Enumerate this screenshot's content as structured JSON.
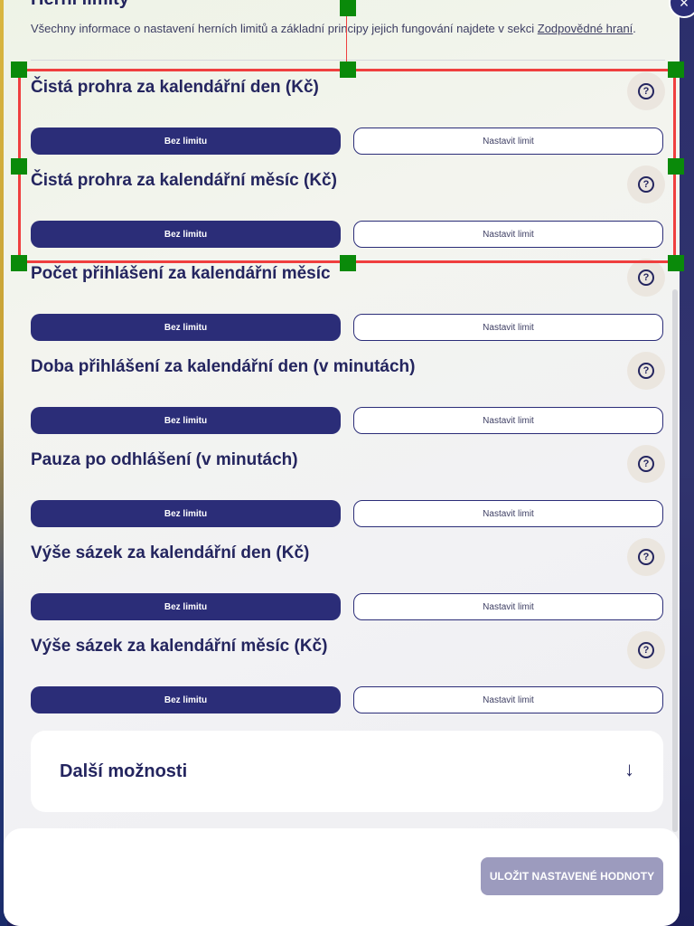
{
  "modal": {
    "title": "Herní limity",
    "info_text": "Všechny informace o nastavení herních limitů a základní principy jejich fungování najdete v sekci",
    "info_link": "Zodpovědné hraní",
    "info_end": ".",
    "close_icon": "×"
  },
  "limits": [
    {
      "label": "Čistá prohra za kalendářní den (Kč)",
      "no_limit": "Bez limitu",
      "set_limit": "Nastavit limit"
    },
    {
      "label": "Čistá prohra za kalendářní měsíc (Kč)",
      "no_limit": "Bez limitu",
      "set_limit": "Nastavit limit"
    },
    {
      "label": "Počet přihlášení za kalendářní měsíc",
      "no_limit": "Bez limitu",
      "set_limit": "Nastavit limit"
    },
    {
      "label": "Doba přihlášení za kalendářní den (v minutách)",
      "no_limit": "Bez limitu",
      "set_limit": "Nastavit limit"
    },
    {
      "label": "Pauza po odhlášení (v minutách)",
      "no_limit": "Bez limitu",
      "set_limit": "Nastavit limit"
    },
    {
      "label": "Výše sázek za kalendářní den (Kč)",
      "no_limit": "Bez limitu",
      "set_limit": "Nastavit limit"
    },
    {
      "label": "Výše sázek za kalendářní měsíc (Kč)",
      "no_limit": "Bez limitu",
      "set_limit": "Nastavit limit"
    }
  ],
  "help_icon": "?",
  "more_options": {
    "label": "Další možnosti",
    "arrow": "↓"
  },
  "footer": {
    "save_label": "ULOŽIT NASTAVENÉ HODNOTY"
  },
  "colors": {
    "primary": "#2b2d78",
    "text": "#24255f",
    "disabled": "#9c9bbe",
    "selection": "#ef3f3f",
    "handle": "#0a8a0a"
  }
}
